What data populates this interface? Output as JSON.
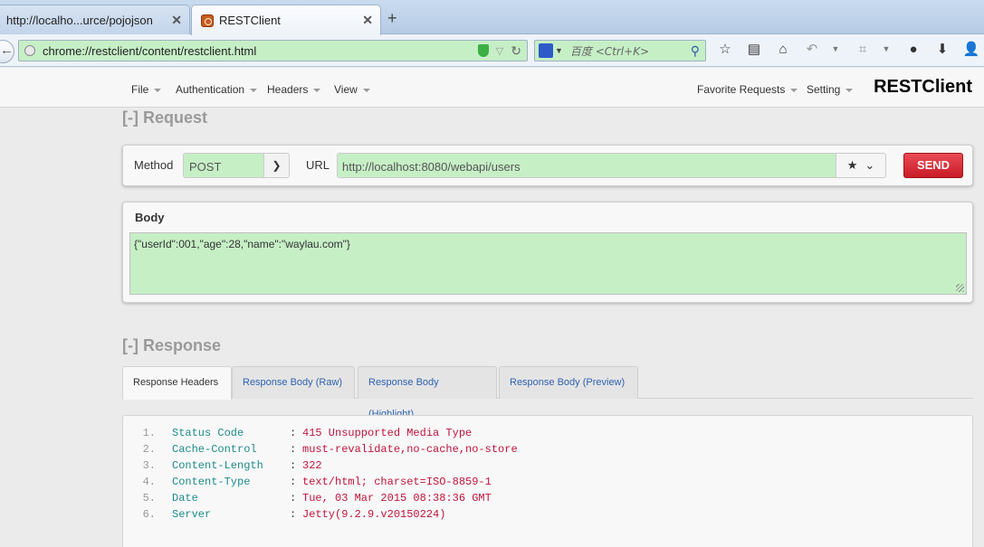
{
  "browser": {
    "tabs": [
      {
        "label": "http://localho...urce/pojojson",
        "active": false
      },
      {
        "label": "RESTClient",
        "active": true
      }
    ],
    "address": "chrome://restclient/content/restclient.html",
    "search_placeholder": "百度 <Ctrl+K>"
  },
  "app": {
    "menu": {
      "file": "File",
      "authentication": "Authentication",
      "headers": "Headers",
      "view": "View",
      "favorite_requests": "Favorite Requests",
      "setting": "Setting"
    },
    "brand": "RESTClient"
  },
  "request": {
    "section_title": "[-] Request",
    "method_label": "Method",
    "method_value": "POST",
    "url_label": "URL",
    "url_value": "http://localhost:8080/webapi/users",
    "send_label": "SEND",
    "body_title": "Body",
    "body_value": "{\"userId\":001,\"age\":28,\"name\":\"waylau.com\"}"
  },
  "response": {
    "section_title": "[-] Response",
    "tabs": [
      {
        "label": "Response Headers",
        "active": true
      },
      {
        "label": "Response Body (Raw)",
        "active": false
      },
      {
        "label": "Response Body (Highlight)",
        "active": false
      },
      {
        "label": "Response Body (Preview)",
        "active": false
      }
    ],
    "headers": [
      {
        "num": "1.",
        "key": "Status Code",
        "value": "415 Unsupported Media Type"
      },
      {
        "num": "2.",
        "key": "Cache-Control",
        "value": "must-revalidate,no-cache,no-store"
      },
      {
        "num": "3.",
        "key": "Content-Length",
        "value": "322"
      },
      {
        "num": "4.",
        "key": "Content-Type",
        "value": "text/html; charset=ISO-8859-1"
      },
      {
        "num": "5.",
        "key": "Date",
        "value": "Tue, 03 Mar 2015 08:38:36 GMT"
      },
      {
        "num": "6.",
        "key": "Server",
        "value": "Jetty(9.2.9.v20150224)"
      }
    ]
  },
  "colors": {
    "input_bg": "#c6efc6",
    "send_button": "#d9232e",
    "header_key": "#1f8b8b",
    "header_value": "#c0143c",
    "tab_link": "#2f62b0"
  }
}
